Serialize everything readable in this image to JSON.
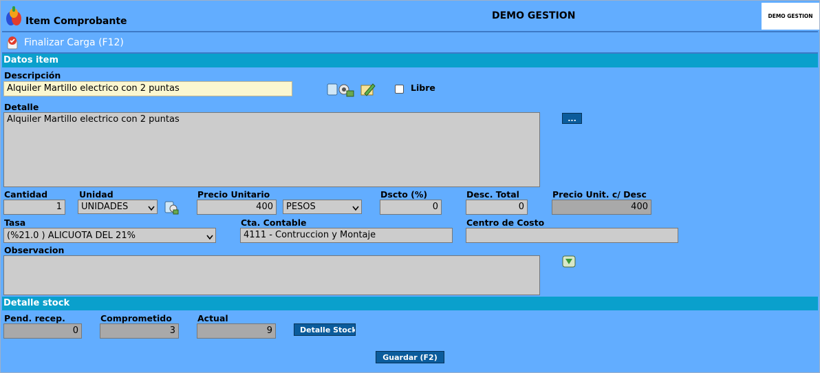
{
  "header": {
    "title": "Item Comprobante",
    "company": "DEMO GESTION",
    "logo_text": "DEMO GESTION"
  },
  "toolbar": {
    "finalize_label": "Finalizar Carga (F12)"
  },
  "sections": {
    "datos_item": "Datos item",
    "detalle_stock": "Detalle stock"
  },
  "form": {
    "descripcion": {
      "label": "Descripción",
      "value": "Alquiler Martillo electrico con 2 puntas"
    },
    "libre": {
      "label": "Libre",
      "checked": false
    },
    "detalle": {
      "label": "Detalle",
      "value": "Alquiler Martillo electrico con 2 puntas",
      "more_label": "..."
    },
    "cantidad": {
      "label": "Cantidad",
      "value": "1"
    },
    "unidad": {
      "label": "Unidad",
      "value": "UNIDADES"
    },
    "precio_unitario": {
      "label": "Precio Unitario",
      "value": "400"
    },
    "moneda": {
      "value": "PESOS"
    },
    "dscto": {
      "label": "Dscto (%)",
      "value": "0"
    },
    "desc_total": {
      "label": "Desc. Total",
      "value": "0"
    },
    "precio_unit_desc": {
      "label": "Precio Unit. c/ Desc",
      "value": "400"
    },
    "tasa": {
      "label": "Tasa",
      "value": "(%21.0 ) ALICUOTA DEL 21%"
    },
    "cta_contable": {
      "label": "Cta. Contable",
      "value": "4111 - Contruccion y Montaje"
    },
    "centro_costo": {
      "label": "Centro de Costo",
      "value": ""
    },
    "observacion": {
      "label": "Observacion",
      "value": ""
    }
  },
  "stock": {
    "pend_recep": {
      "label": "Pend. recep.",
      "value": "0"
    },
    "comprometido": {
      "label": "Comprometido",
      "value": "3"
    },
    "actual": {
      "label": "Actual",
      "value": "9"
    },
    "detalle_btn": "Detalle Stock"
  },
  "footer": {
    "save_label": "Guardar (F2)"
  },
  "colors": {
    "background": "#62adff",
    "section": "#0aa0cc",
    "button": "#0b5c9c"
  }
}
